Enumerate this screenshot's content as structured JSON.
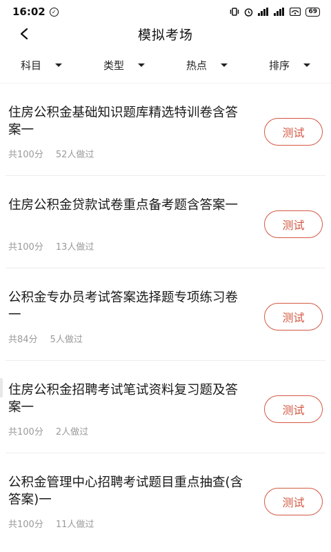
{
  "status_bar": {
    "time": "16:02",
    "battery": "69"
  },
  "header": {
    "title": "模拟考场"
  },
  "filters": [
    {
      "label": "科目"
    },
    {
      "label": "类型"
    },
    {
      "label": "热点"
    },
    {
      "label": "排序"
    }
  ],
  "exams": [
    {
      "title": "住房公积金基础知识题库精选特训卷含答案一",
      "score": "共100分",
      "takers": "52人做过",
      "button": "测试"
    },
    {
      "title": "住房公积金贷款试卷重点备考题含答案一",
      "score": "共100分",
      "takers": "13人做过",
      "button": "测试"
    },
    {
      "title": "公积金专办员考试答案选择题专项练习卷一",
      "score": "共84分",
      "takers": "5人做过",
      "button": "测试"
    },
    {
      "title": "住房公积金招聘考试笔试资料复习题及答案一",
      "score": "共100分",
      "takers": "2人做过",
      "button": "测试"
    },
    {
      "title": "公积金管理中心招聘考试题目重点抽查(含答案)一",
      "score": "共100分",
      "takers": "11人做过",
      "button": "测试"
    }
  ],
  "colors": {
    "accent": "#d25741",
    "meta_text": "#9a9a9a"
  }
}
